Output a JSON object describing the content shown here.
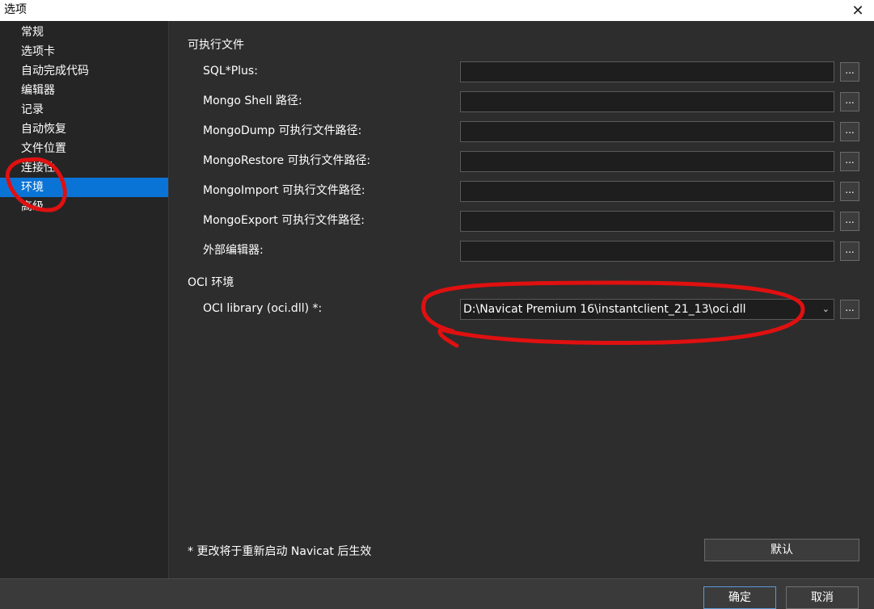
{
  "window": {
    "title": "选项"
  },
  "sidebar": {
    "items": [
      {
        "label": "常规"
      },
      {
        "label": "选项卡"
      },
      {
        "label": "自动完成代码"
      },
      {
        "label": "编辑器"
      },
      {
        "label": "记录"
      },
      {
        "label": "自动恢复"
      },
      {
        "label": "文件位置"
      },
      {
        "label": "连接性"
      },
      {
        "label": "环境"
      },
      {
        "label": "高级"
      }
    ],
    "active_index": 8
  },
  "main": {
    "executables": {
      "title": "可执行文件",
      "fields": [
        {
          "label": "SQL*Plus:",
          "value": ""
        },
        {
          "label": "Mongo Shell 路径:",
          "value": ""
        },
        {
          "label": "MongoDump 可执行文件路径:",
          "value": ""
        },
        {
          "label": "MongoRestore 可执行文件路径:",
          "value": ""
        },
        {
          "label": "MongoImport 可执行文件路径:",
          "value": ""
        },
        {
          "label": "MongoExport 可执行文件路径:",
          "value": ""
        },
        {
          "label": "外部编辑器:",
          "value": ""
        }
      ],
      "browse_label": "..."
    },
    "oci": {
      "title": "OCI 环境",
      "label": "OCI library (oci.dll) *:",
      "value": "D:\\Navicat Premium 16\\instantclient_21_13\\oci.dll",
      "browse_label": "..."
    },
    "footnote": "* 更改将于重新启动 Navicat 后生效",
    "default_button": "默认"
  },
  "footer": {
    "ok": "确定",
    "cancel": "取消"
  },
  "colors": {
    "accent": "#0a74d6",
    "annotation": "#e01010"
  }
}
